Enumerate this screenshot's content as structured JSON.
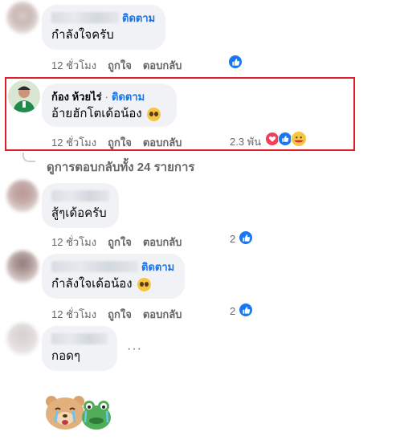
{
  "comments": [
    {
      "author": "",
      "follow": "ติดตาม",
      "text": "กำลังใจครับ",
      "time": "12 ชั่วโมง",
      "like": "ถูกใจ",
      "reply": "ตอบกลับ",
      "reaction_count": ""
    },
    {
      "author": "ก้อง ห้วยไร่",
      "dot": "·",
      "follow": "ติดตาม",
      "text": "อ้ายฮักโตเด้อน้อง",
      "time": "12 ชั่วโมง",
      "like": "ถูกใจ",
      "reply": "ตอบกลับ",
      "reaction_count": "2.3 พัน"
    },
    {
      "author": "",
      "text": "สู้ๆเด้อครับ",
      "time": "12 ชั่วโมง",
      "like": "ถูกใจ",
      "reply": "ตอบกลับ",
      "reaction_count": "2"
    },
    {
      "author": "",
      "follow": "ติดตาม",
      "text": "กำลังใจเด้อน้อง",
      "time": "12 ชั่วโมง",
      "like": "ถูกใจ",
      "reply": "ตอบกลับ",
      "reaction_count": "2"
    },
    {
      "author": "",
      "text": "กอดๆ",
      "more": "···"
    }
  ],
  "view_replies": "ดูการตอบกลับทั้ง 24 รายการ",
  "colors": {
    "link_blue": "#1b74e4",
    "like_blue": "#1877f2",
    "highlight_red": "#e0202b",
    "bubble_bg": "#f0f2f5",
    "meta_gray": "#65676b"
  },
  "icons": [
    "like-icon",
    "love-icon",
    "care-icon",
    "emoji-face-icon",
    "sticker-bear-frog"
  ]
}
